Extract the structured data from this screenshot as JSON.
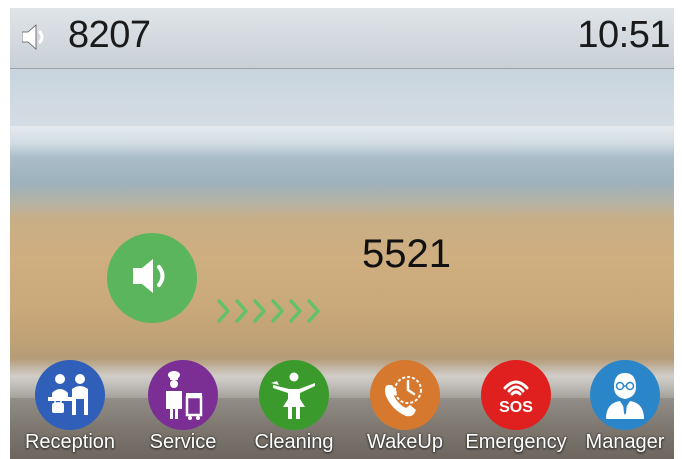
{
  "status_bar": {
    "extension": "8207",
    "time": "10:51",
    "volume_icon": "speaker-icon"
  },
  "call": {
    "number": "5521",
    "speaker_icon": "speaker-icon",
    "progress_icon": "chevrons-icon"
  },
  "colors": {
    "speaker_green": "#5ab55c",
    "reception": "#2f5fb8",
    "service": "#7b2f95",
    "cleaning": "#3a9b2c",
    "wakeup": "#d7782f",
    "emergency": "#e0201e",
    "manager": "#2a86c9"
  },
  "dock": {
    "items": [
      {
        "label": "Reception",
        "icon": "reception-desk-icon"
      },
      {
        "label": "Service",
        "icon": "chef-icon"
      },
      {
        "label": "Cleaning",
        "icon": "cleaning-icon"
      },
      {
        "label": "WakeUp",
        "icon": "alarm-phone-icon"
      },
      {
        "label": "Emergency",
        "icon": "sos-icon"
      },
      {
        "label": "Manager",
        "icon": "manager-icon"
      }
    ]
  }
}
